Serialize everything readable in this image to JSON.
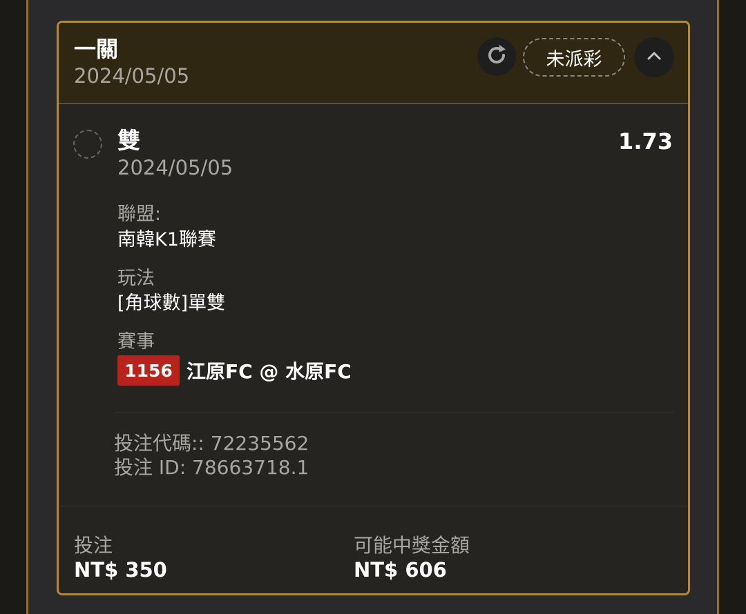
{
  "card": {
    "bet_type": "一關",
    "date": "2024/05/05",
    "status": "未派彩",
    "icons": {
      "refresh": "refresh-icon",
      "collapse": "chevron-up-icon"
    }
  },
  "selection": {
    "name": "雙",
    "odds": "1.73",
    "date": "2024/05/05",
    "league_label": "聯盟:",
    "league_value": "南韓K1聯賽",
    "market_label": "玩法",
    "market_value": "[角球數]單雙",
    "event_label": "賽事",
    "match_number": "1156",
    "match_name": "江原FC @ 水原FC"
  },
  "codes": {
    "bet_code": "投注代碼:: 72235562",
    "bet_id": "投注 ID: 78663718.1"
  },
  "footer": {
    "stake_label": "投注",
    "stake_value": "NT$ 350",
    "payout_label": "可能中獎金額",
    "payout_value": "NT$ 606"
  },
  "colors": {
    "accent_border": "#b08a3a",
    "header_bg": "#2f2712",
    "match_badge": "#b8241c"
  }
}
